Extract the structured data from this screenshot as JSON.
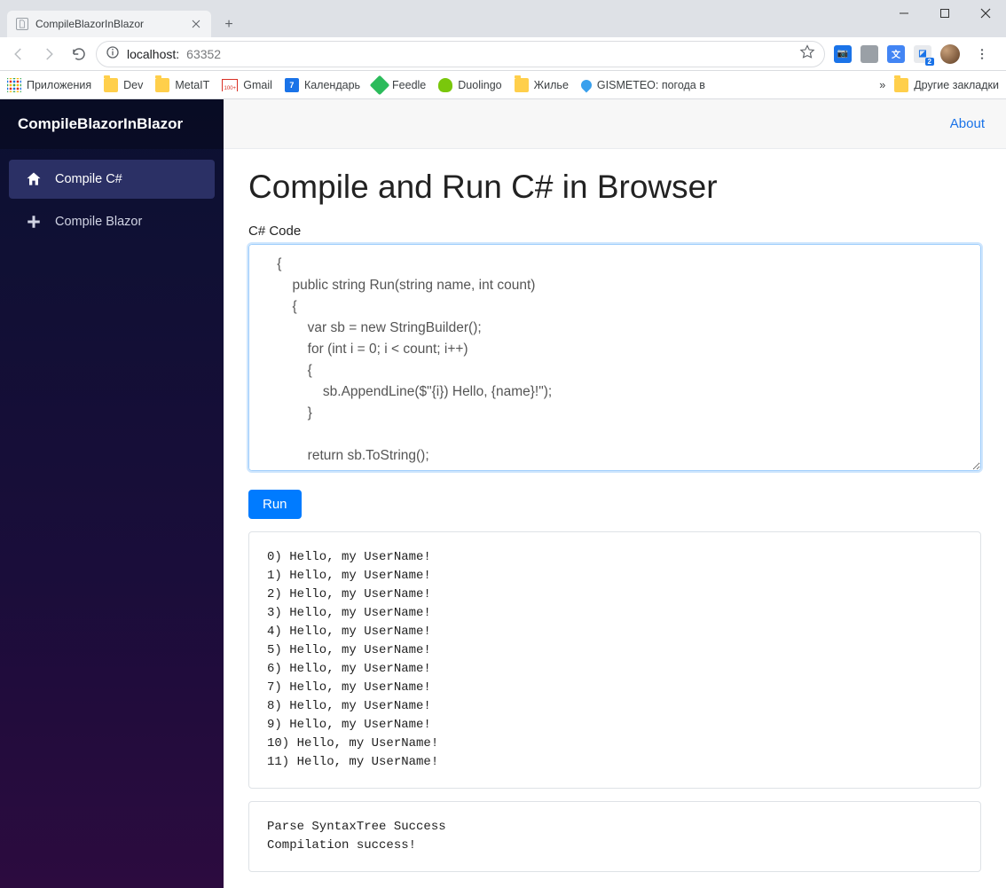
{
  "browser": {
    "tab_title": "CompileBlazorInBlazor",
    "url_host": "localhost:",
    "url_port": "63352",
    "bookmarks": {
      "apps": "Приложения",
      "dev": "Dev",
      "metait": "MetaIT",
      "gmail": "Gmail",
      "calendar": "Календарь",
      "calendar_day": "7",
      "feedle": "Feedle",
      "duolingo": "Duolingo",
      "housing": "Жилье",
      "gismeteo": "GISMETEO: погода в",
      "more": "»",
      "other": "Другие закладки"
    }
  },
  "app": {
    "brand": "CompileBlazorInBlazor",
    "nav": {
      "compile_cs": "Compile C#",
      "compile_blazor": "Compile Blazor"
    },
    "about": "About",
    "heading": "Compile and Run C# in Browser",
    "code_label": "C# Code",
    "code": "    {\n        public string Run(string name, int count)\n        {\n            var sb = new StringBuilder();\n            for (int i = 0; i < count; i++)\n            {\n                sb.AppendLine($\"{i}) Hello, {name}!\");\n            }\n\n            return sb.ToString();\n        }",
    "run_label": "Run",
    "output": "0) Hello, my UserName!\n1) Hello, my UserName!\n2) Hello, my UserName!\n3) Hello, my UserName!\n4) Hello, my UserName!\n5) Hello, my UserName!\n6) Hello, my UserName!\n7) Hello, my UserName!\n8) Hello, my UserName!\n9) Hello, my UserName!\n10) Hello, my UserName!\n11) Hello, my UserName!",
    "status": "Parse SyntaxTree Success\nCompilation success!"
  }
}
